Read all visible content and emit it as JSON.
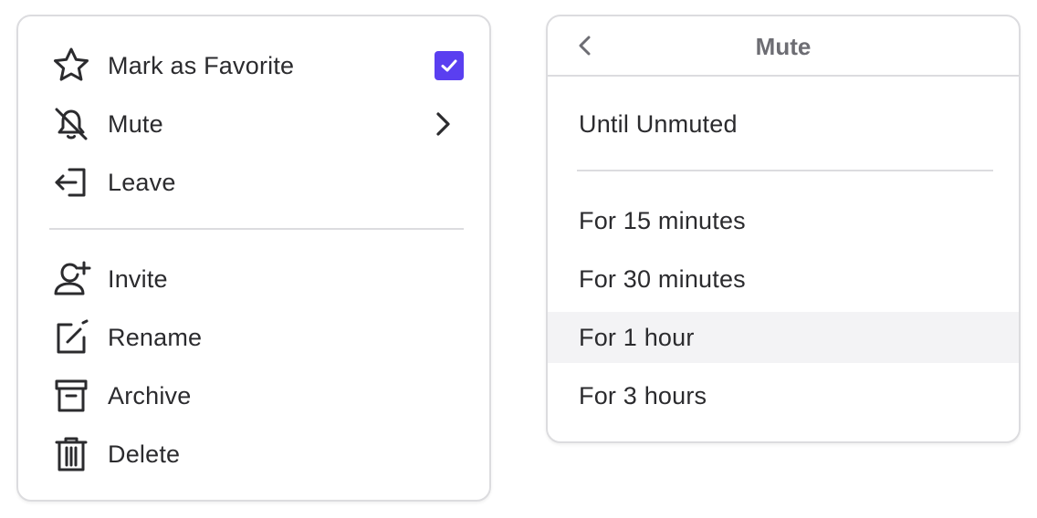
{
  "main_menu": {
    "items": [
      {
        "label": "Mark as Favorite",
        "icon": "star-icon",
        "checked": true
      },
      {
        "label": "Mute",
        "icon": "bell-off-icon",
        "has_submenu": true
      },
      {
        "label": "Leave",
        "icon": "leave-icon"
      },
      {
        "label": "Invite",
        "icon": "user-plus-icon"
      },
      {
        "label": "Rename",
        "icon": "edit-icon"
      },
      {
        "label": "Archive",
        "icon": "archive-icon"
      },
      {
        "label": "Delete",
        "icon": "trash-icon"
      }
    ]
  },
  "mute_menu": {
    "title": "Mute",
    "back_icon": "chevron-left-icon",
    "options": [
      {
        "label": "Until Unmuted"
      },
      {
        "label": "For 15 minutes"
      },
      {
        "label": "For 30 minutes"
      },
      {
        "label": "For 1 hour",
        "highlighted": true
      },
      {
        "label": "For 3 hours"
      }
    ]
  },
  "colors": {
    "accent": "#5a3ff0",
    "text": "#2b2b2e",
    "border": "#dcdcdf",
    "highlight": "#f3f3f5"
  }
}
